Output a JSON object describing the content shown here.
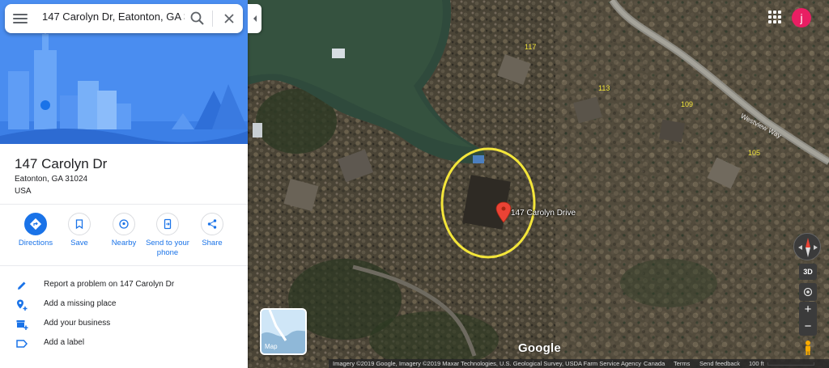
{
  "search": {
    "value": "147 Carolyn Dr, Eatonton, GA 31024",
    "menu_icon": "hamburger-menu-icon",
    "search_icon": "search-icon",
    "close_icon": "close-icon"
  },
  "place": {
    "title": "147 Carolyn Dr",
    "address_lines": [
      "Eatonton, GA 31024",
      "USA"
    ]
  },
  "actions": [
    {
      "label": "Directions",
      "icon": "directions-icon"
    },
    {
      "label": "Save",
      "icon": "bookmark-icon"
    },
    {
      "label": "Nearby",
      "icon": "nearby-icon"
    },
    {
      "label": "Send to your phone",
      "icon": "send-to-phone-icon"
    },
    {
      "label": "Share",
      "icon": "share-icon"
    }
  ],
  "list_items": [
    {
      "label": "Report a problem on 147 Carolyn Dr",
      "icon": "pencil-icon"
    },
    {
      "label": "Add a missing place",
      "icon": "add-place-icon"
    },
    {
      "label": "Add your business",
      "icon": "business-icon"
    },
    {
      "label": "Add a label",
      "icon": "label-icon"
    }
  ],
  "map": {
    "pin_label": "147 Carolyn Drive",
    "house_numbers": [
      "117",
      "113",
      "109",
      "105"
    ],
    "road_label": "Westview Way",
    "logo": "Google",
    "layer_label": "Map",
    "btn_3d": "3D",
    "zoom_in": "+",
    "zoom_out": "−",
    "avatar_letter": "j",
    "footer": {
      "imagery": "Imagery ©2019 Google, Imagery ©2019 Maxar Technologies, U.S. Geological Survey, USDA Farm Service Agency",
      "country": "Canada",
      "terms": "Terms",
      "feedback": "Send feedback",
      "scale": "100 ft"
    }
  },
  "colors": {
    "accent": "#1a73e8",
    "hero_bg": "#4a8df0",
    "pin": "#ea4335",
    "highlight_circle": "#f3e53a",
    "avatar": "#e91e63"
  }
}
